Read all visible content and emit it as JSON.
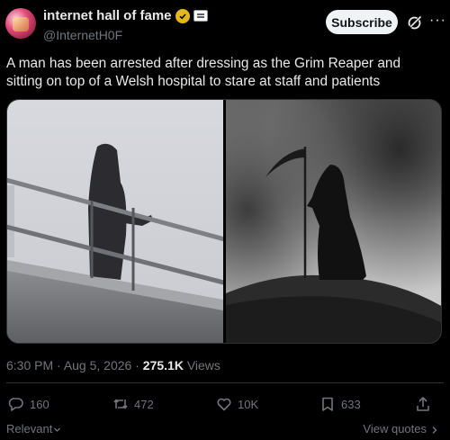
{
  "author": {
    "display_name": "internet hall of fame",
    "handle": "@InternetH0F"
  },
  "header": {
    "subscribe_label": "Subscribe",
    "more_label": "···"
  },
  "tweet": {
    "text": "A man has been arrested after dressing as the Grim Reaper and sitting on top of a Welsh hospital to stare at staff and patients"
  },
  "meta": {
    "time": "6:30 PM",
    "sep1": " · ",
    "date": "Aug 5, 2026",
    "sep2": " · ",
    "views_count": "275.1K",
    "views_label": " Views"
  },
  "actions": {
    "replies": "160",
    "reposts": "472",
    "likes": "10K",
    "bookmarks": "633"
  },
  "footer": {
    "sort_label": "Relevant",
    "view_quotes_label": "View quotes"
  },
  "colors": {
    "background": "#000000",
    "text": "#e7e9ea",
    "muted": "#71767b",
    "verified_gold": "#e2b719",
    "subscribe_bg": "#eff3f4"
  },
  "icons": [
    "verified-badge-icon",
    "affiliate-badge-icon",
    "grok-icon",
    "more-icon",
    "reply-icon",
    "repost-icon",
    "like-icon",
    "bookmark-icon",
    "share-icon",
    "chevron-down-icon",
    "chevron-right-icon"
  ]
}
